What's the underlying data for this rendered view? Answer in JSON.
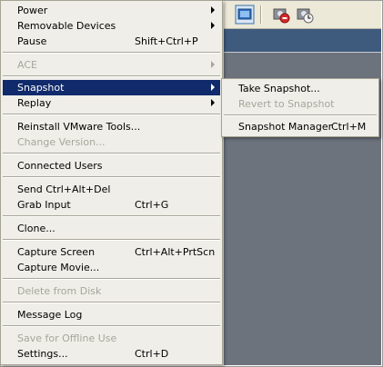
{
  "main_menu": {
    "items": [
      {
        "label": "Power",
        "shortcut": "",
        "submenu": true,
        "enabled": true
      },
      {
        "label": "Removable Devices",
        "shortcut": "",
        "submenu": true,
        "enabled": true
      },
      {
        "label": "Pause",
        "shortcut": "Shift+Ctrl+P",
        "submenu": false,
        "enabled": true
      },
      {
        "label": "ACE",
        "shortcut": "",
        "submenu": true,
        "enabled": false
      },
      {
        "label": "Snapshot",
        "shortcut": "",
        "submenu": true,
        "enabled": true,
        "selected": true
      },
      {
        "label": "Replay",
        "shortcut": "",
        "submenu": true,
        "enabled": true
      },
      {
        "label": "Reinstall VMware Tools...",
        "shortcut": "",
        "submenu": false,
        "enabled": true
      },
      {
        "label": "Change Version...",
        "shortcut": "",
        "submenu": false,
        "enabled": false
      },
      {
        "label": "Connected Users",
        "shortcut": "",
        "submenu": false,
        "enabled": true
      },
      {
        "label": "Send Ctrl+Alt+Del",
        "shortcut": "",
        "submenu": false,
        "enabled": true
      },
      {
        "label": "Grab Input",
        "shortcut": "Ctrl+G",
        "submenu": false,
        "enabled": true
      },
      {
        "label": "Clone...",
        "shortcut": "",
        "submenu": false,
        "enabled": true
      },
      {
        "label": "Capture Screen",
        "shortcut": "Ctrl+Alt+PrtScn",
        "submenu": false,
        "enabled": true
      },
      {
        "label": "Capture Movie...",
        "shortcut": "",
        "submenu": false,
        "enabled": true
      },
      {
        "label": "Delete from Disk",
        "shortcut": "",
        "submenu": false,
        "enabled": false
      },
      {
        "label": "Message Log",
        "shortcut": "",
        "submenu": false,
        "enabled": true
      },
      {
        "label": "Save for Offline Use",
        "shortcut": "",
        "submenu": false,
        "enabled": false
      },
      {
        "label": "Settings...",
        "shortcut": "Ctrl+D",
        "submenu": false,
        "enabled": true
      }
    ]
  },
  "snapshot_submenu": {
    "items": [
      {
        "label": "Take Snapshot...",
        "shortcut": "",
        "enabled": true
      },
      {
        "label": "Revert to Snapshot",
        "shortcut": "",
        "enabled": false
      },
      {
        "label": "Snapshot Manager",
        "shortcut": "Ctrl+M",
        "enabled": true
      }
    ]
  },
  "toolbar": {
    "icons": [
      "view-window-icon",
      "snapshot-revert-icon",
      "snapshot-manager-icon"
    ]
  }
}
